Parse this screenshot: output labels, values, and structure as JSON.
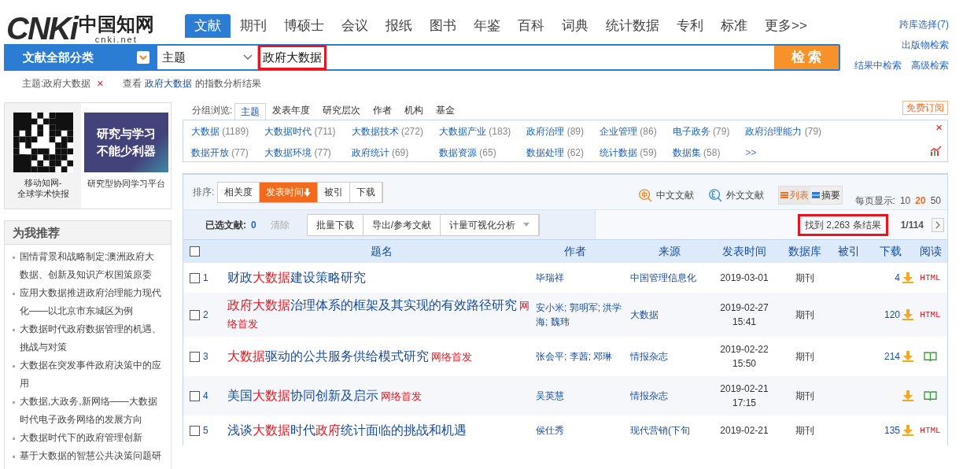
{
  "logo": {
    "mark": "CNKi",
    "name": "中国知网",
    "domain": "cnki.net"
  },
  "nav": [
    {
      "label": "文献",
      "selected": true
    },
    {
      "label": "期刊",
      "selected": false
    },
    {
      "label": "博硕士",
      "selected": false
    },
    {
      "label": "会议",
      "selected": false
    },
    {
      "label": "报纸",
      "selected": false
    },
    {
      "label": "图书",
      "selected": false
    },
    {
      "label": "年鉴",
      "selected": false
    },
    {
      "label": "百科",
      "selected": false
    },
    {
      "label": "词典",
      "selected": false
    },
    {
      "label": "统计数据",
      "selected": false
    },
    {
      "label": "专利",
      "selected": false
    },
    {
      "label": "标准",
      "selected": false
    },
    {
      "label": "更多>>",
      "selected": false
    }
  ],
  "side_links": [
    "跨库选择(7)",
    "出版物检索",
    "结果中检索",
    "高级检索"
  ],
  "search": {
    "category": "文献全部分类",
    "field": "主题",
    "value": "政府大数据",
    "button": "检 索"
  },
  "query_bar": {
    "condition": "主题:政府大数据",
    "remove": "×",
    "index_prefix": "查看",
    "index_term": "政府大数据",
    "index_suffix": "的指数分析结果"
  },
  "ad": {
    "qr_caption": [
      "移动知网-",
      "全球学术快报"
    ],
    "banner_lines": [
      "研究与学习",
      "不能少利器"
    ],
    "banner_caption": "研究型协同学习平台"
  },
  "recommend": {
    "title": "为我推荐",
    "items": [
      "国情背景和战略制定:澳洲政府大数据、创新及知识产权国策原委",
      "应用大数据推进政府治理能力现代化——以北京市东城区为例",
      "大数据时代政府数据管理的机遇、挑战与对策",
      "大数据在突发事件政府决策中的应用",
      "大数据,大政务,新网络——大数据时代电子政务网络的发展方向",
      "大数据时代下的政府管理创新",
      "基于大数据的智慧公共决策问题研"
    ]
  },
  "groups": {
    "label": "分组浏览:",
    "tabs": [
      {
        "label": "主题",
        "selected": true
      },
      {
        "label": "发表年度",
        "selected": false
      },
      {
        "label": "研究层次",
        "selected": false
      },
      {
        "label": "作者",
        "selected": false
      },
      {
        "label": "机构",
        "selected": false
      },
      {
        "label": "基金",
        "selected": false
      }
    ],
    "subscribe": "免费订阅",
    "close": "×",
    "more": ">>",
    "tags": [
      {
        "name": "大数据",
        "count": "(1189)"
      },
      {
        "name": "大数据时代",
        "count": "(711)"
      },
      {
        "name": "大数据技术",
        "count": "(272)"
      },
      {
        "name": "大数据产业",
        "count": "(183)"
      },
      {
        "name": "政府治理",
        "count": "(89)"
      },
      {
        "name": "企业管理",
        "count": "(86)"
      },
      {
        "name": "电子政务",
        "count": "(79)"
      },
      {
        "name": "政府治理能力",
        "count": "(79)"
      },
      {
        "name": "数据开放",
        "count": "(77)"
      },
      {
        "name": "大数据环境",
        "count": "(77)"
      },
      {
        "name": "政府统计",
        "count": "(69)"
      },
      {
        "name": "数据资源",
        "count": "(65)"
      },
      {
        "name": "数据处理",
        "count": "(62)"
      },
      {
        "name": "统计数据",
        "count": "(59)"
      },
      {
        "name": "数据集",
        "count": "(58)"
      }
    ]
  },
  "sort": {
    "label": "排序:",
    "options": [
      {
        "label": "相关度",
        "selected": false
      },
      {
        "label": "发表时间",
        "selected": true
      },
      {
        "label": "被引",
        "selected": false
      },
      {
        "label": "下载",
        "selected": false
      }
    ]
  },
  "languages": [
    {
      "kind": "zh",
      "label": "中文文献"
    },
    {
      "kind": "en",
      "label": "外文文献"
    }
  ],
  "views": [
    {
      "label": "列表",
      "selected": true
    },
    {
      "label": "摘要",
      "selected": false
    }
  ],
  "page_size": {
    "label": "每页显示:",
    "options": [
      {
        "label": "10",
        "selected": false
      },
      {
        "label": "20",
        "selected": true
      },
      {
        "label": "50",
        "selected": false
      }
    ]
  },
  "selection": {
    "label": "已选文献:",
    "count": "0",
    "clear": "清除",
    "actions": [
      "批量下载",
      "导出/参考文献",
      "计量可视化分析"
    ]
  },
  "result_count": "找到 2,263 条结果",
  "pager": "1/114",
  "table": {
    "header_checked": false,
    "columns": [
      "题名",
      "作者",
      "来源",
      "发表时间",
      "数据库",
      "被引",
      "下载",
      "阅读"
    ],
    "rows": [
      {
        "checked": false,
        "num": "1",
        "title": [
          {
            "text": "财政",
            "kind": "plain"
          },
          {
            "text": "大数据",
            "kind": "hit"
          },
          {
            "text": "建设策略研究",
            "kind": "plain"
          }
        ],
        "authors": "毕瑞祥",
        "source": "中国管理信息化",
        "date": "2019-03-01",
        "db": "期刊",
        "downloads": "4",
        "read": {
          "kind": "html",
          "text": "HTML"
        }
      },
      {
        "checked": false,
        "num": "2",
        "title": [
          {
            "text": "政府大数据",
            "kind": "hit"
          },
          {
            "text": "治理体系的框架及其实现的有效路径研究",
            "kind": "plain"
          },
          {
            "text": "网络首发",
            "kind": "first_online"
          }
        ],
        "authors": "安小米; 郭明军; 洪学海; 魏玮",
        "source": "大数据",
        "date": "2019-02-27",
        "time": "15:41",
        "db": "期刊",
        "downloads": "120",
        "read": {
          "kind": "html",
          "text": "HTML"
        }
      },
      {
        "checked": false,
        "num": "3",
        "title": [
          {
            "text": "大数据",
            "kind": "hit"
          },
          {
            "text": "驱动的公共服务供给模式研究",
            "kind": "plain"
          },
          {
            "text": "网络首发",
            "kind": "first_online"
          }
        ],
        "authors": "张会平; 李茜; 邓琳",
        "source": "情报杂志",
        "date": "2019-02-22",
        "time": "15:50",
        "db": "期刊",
        "downloads": "214",
        "read": {
          "kind": "book"
        }
      },
      {
        "checked": false,
        "num": "4",
        "title": [
          {
            "text": "美国",
            "kind": "plain"
          },
          {
            "text": "大数据",
            "kind": "hit"
          },
          {
            "text": "协同创新及启示",
            "kind": "plain"
          },
          {
            "text": "网络首发",
            "kind": "first_online"
          }
        ],
        "authors": "吴英慧",
        "source": "情报杂志",
        "date": "2019-02-21",
        "time": "17:15",
        "db": "期刊",
        "read": {
          "kind": "book"
        }
      },
      {
        "checked": false,
        "num": "5",
        "title": [
          {
            "text": "浅谈",
            "kind": "plain"
          },
          {
            "text": "大数据",
            "kind": "hit"
          },
          {
            "text": "时代",
            "kind": "plain"
          },
          {
            "text": "政府",
            "kind": "hit"
          },
          {
            "text": "统计面临的挑战和机遇",
            "kind": "plain"
          }
        ],
        "authors": "侯仕秀",
        "source": "现代营销(下旬",
        "date": "2019-02-21",
        "db": "期刊",
        "downloads": "135",
        "read": {
          "kind": "html",
          "text": "HTML"
        }
      }
    ]
  }
}
